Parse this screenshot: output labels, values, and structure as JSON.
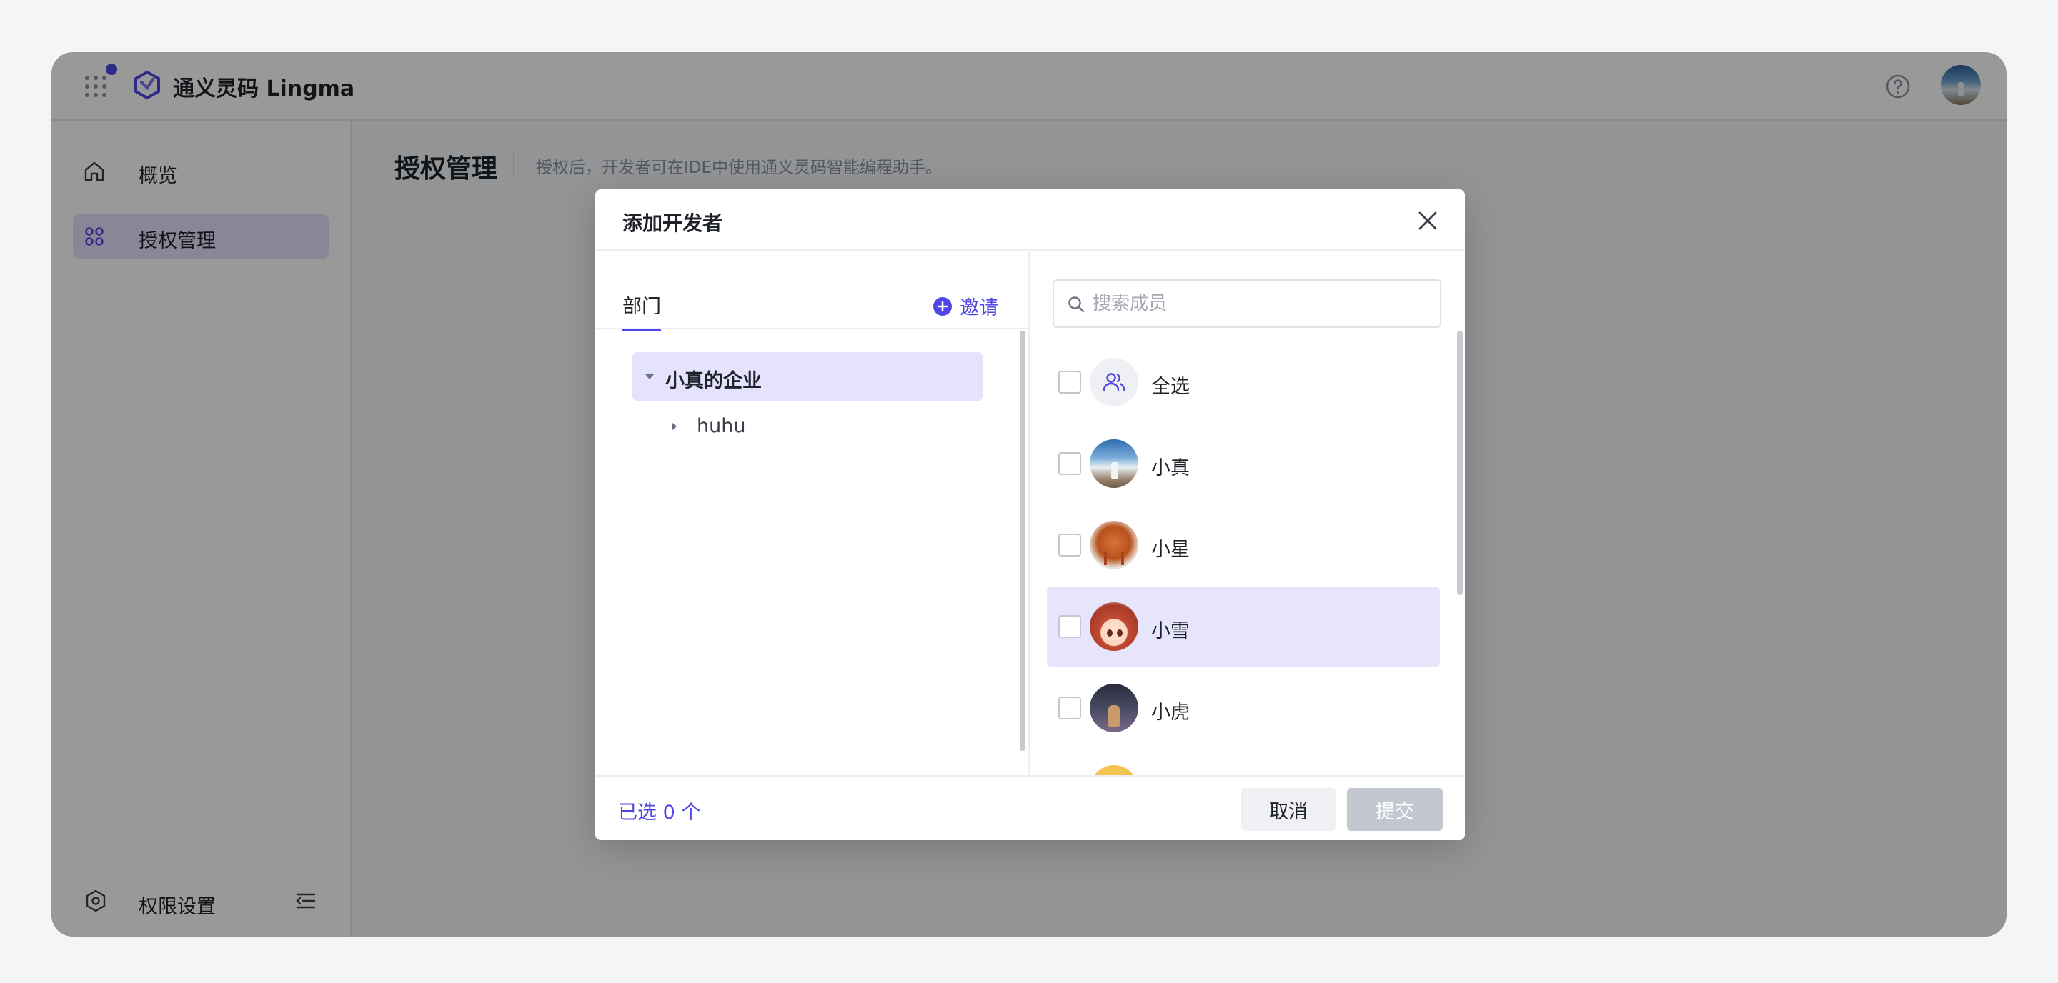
{
  "app": {
    "title": "通义灵码 Lingma"
  },
  "sidebar": {
    "items": [
      {
        "label": "概览",
        "icon": "home-icon"
      },
      {
        "label": "授权管理",
        "icon": "grid-icon",
        "active": true
      }
    ],
    "bottom": {
      "label": "权限设置",
      "icon": "settings-icon"
    }
  },
  "main": {
    "title": "授权管理",
    "subtitle": "授权后，开发者可在IDE中使用通义灵码智能编程助手。"
  },
  "modal": {
    "title": "添加开发者",
    "left": {
      "tab_label": "部门",
      "invite_label": "邀请",
      "tree": {
        "root": {
          "label": "小真的企业",
          "expanded": true
        },
        "children": [
          {
            "label": "huhu",
            "expanded": false
          }
        ]
      }
    },
    "right": {
      "search_placeholder": "搜索成员",
      "members": [
        {
          "name": "全选",
          "avatar": "group-icon"
        },
        {
          "name": "小真",
          "avatar": "photo"
        },
        {
          "name": "小星",
          "avatar": "photo"
        },
        {
          "name": "小雪",
          "avatar": "photo",
          "hover": true
        },
        {
          "name": "小虎",
          "avatar": "photo"
        }
      ]
    },
    "footer": {
      "selected_text": "已选 0 个",
      "cancel_label": "取消",
      "submit_label": "提交"
    }
  },
  "colors": {
    "accent": "#4f46e5",
    "active_bg": "#e4e2fc",
    "overlay": "rgba(0,0,0,0.40)"
  }
}
